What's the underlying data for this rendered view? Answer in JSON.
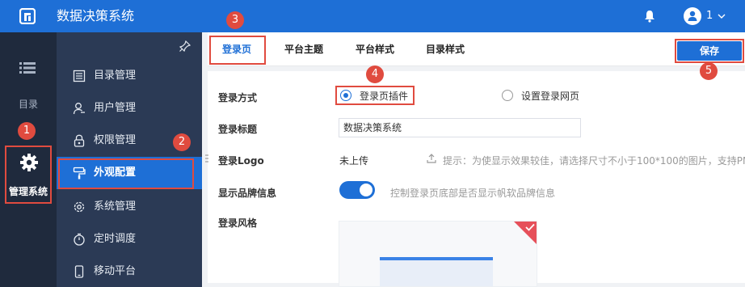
{
  "header": {
    "app_title": "数据决策系统",
    "user_number": "1"
  },
  "rail": {
    "catalog_label": "目录",
    "manage_label": "管理系统"
  },
  "menu": {
    "items": [
      {
        "label": "目录管理",
        "icon": "catalog-icon"
      },
      {
        "label": "用户管理",
        "icon": "user-icon"
      },
      {
        "label": "权限管理",
        "icon": "lock-icon"
      },
      {
        "label": "外观配置",
        "icon": "brush-icon"
      },
      {
        "label": "系统管理",
        "icon": "settings-icon"
      },
      {
        "label": "定时调度",
        "icon": "timer-icon"
      },
      {
        "label": "移动平台",
        "icon": "mobile-icon"
      }
    ]
  },
  "tabs": [
    "登录页",
    "平台主题",
    "平台样式",
    "目录样式"
  ],
  "save_label": "保存",
  "form": {
    "login_method_label": "登录方式",
    "login_method_options": [
      "登录页插件",
      "设置登录网页"
    ],
    "login_method_selected": "登录页插件",
    "login_title_label": "登录标题",
    "login_title_value": "数据决策系统",
    "login_logo_label": "登录Logo",
    "login_logo_status": "未上传",
    "login_logo_hint": "提示：为使显示效果较佳，请选择尺寸不小于100*100的图片，支持PN",
    "brand_label": "显示品牌信息",
    "brand_hint": "控制登录页底部是否显示帆软品牌信息",
    "brand_enabled": true,
    "login_style_label": "登录风格"
  },
  "steps": [
    "1",
    "2",
    "3",
    "4",
    "5"
  ],
  "colors": {
    "brand_blue": "#1e6fd6",
    "sidebar_dark": "#1f2a3d",
    "menu_bg": "#2b3a55",
    "annotation_red": "#e04b3f"
  }
}
